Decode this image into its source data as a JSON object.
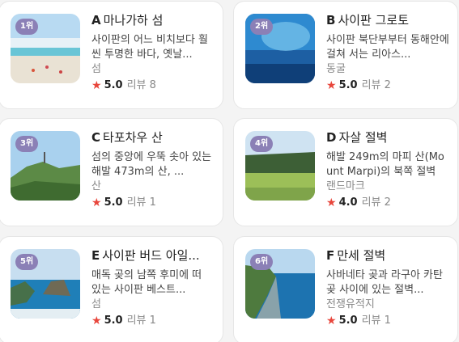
{
  "cards": [
    {
      "rank": "1위",
      "letter": "A",
      "name": "마나가하 섬",
      "desc": "사이판의 어느 비치보다 훨씬 투명한 바다, 옛날...",
      "category": "섬",
      "score": "5.0",
      "reviews": "리뷰 8"
    },
    {
      "rank": "2위",
      "letter": "B",
      "name": "사이판 그로토",
      "desc": "사이판 북단부부터 동해안에 걸쳐 서는 리아스...",
      "category": "동굴",
      "score": "5.0",
      "reviews": "리뷰 2"
    },
    {
      "rank": "3위",
      "letter": "C",
      "name": "타포차우 산",
      "desc": "섬의 중앙에 우뚝 솟아 있는 해발 473m의 산, ...",
      "category": "산",
      "score": "5.0",
      "reviews": "리뷰 1"
    },
    {
      "rank": "4위",
      "letter": "D",
      "name": "자살 절벽",
      "desc": "해발 249m의 마피 산(Mount Marpi)의 북쪽 절벽",
      "category": "랜드마크",
      "score": "4.0",
      "reviews": "리뷰 2"
    },
    {
      "rank": "5위",
      "letter": "E",
      "name": "사이판 버드 아일...",
      "desc": "매독 곶의 남쪽 후미에 떠 있는 사이판 베스트...",
      "category": "섬",
      "score": "5.0",
      "reviews": "리뷰 1"
    },
    {
      "rank": "6위",
      "letter": "F",
      "name": "만세 절벽",
      "desc": "사바네타 곶과 라구아 카탄 곶 사이에 있는 절벽...",
      "category": "전쟁유적지",
      "score": "5.0",
      "reviews": "리뷰 1"
    }
  ],
  "icons": {
    "rating": "star-icon"
  },
  "colors": {
    "rank_badge": "#8b80b6",
    "star": "#e8463c"
  }
}
